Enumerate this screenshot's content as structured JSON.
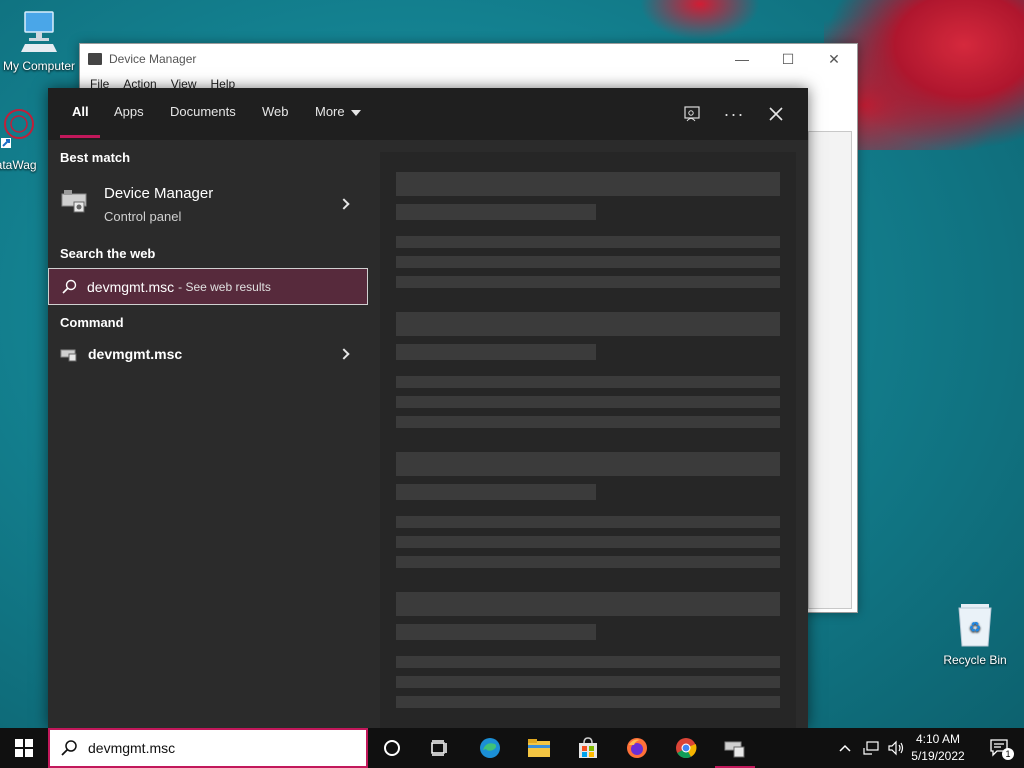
{
  "desktop": {
    "icons": [
      {
        "label": "My Computer"
      },
      {
        "label": "DataWag"
      },
      {
        "label": "Recycle Bin"
      }
    ]
  },
  "background_window": {
    "title": "Device Manager",
    "menu": [
      "File",
      "Action",
      "View",
      "Help"
    ]
  },
  "search": {
    "tabs": [
      {
        "label": "All",
        "active": true
      },
      {
        "label": "Apps"
      },
      {
        "label": "Documents"
      },
      {
        "label": "Web"
      },
      {
        "label": "More"
      }
    ],
    "sections": {
      "best_match": "Best match",
      "search_web": "Search the web",
      "command": "Command"
    },
    "best_match_item": {
      "title": "Device Manager",
      "subtitle": "Control panel"
    },
    "web_item": {
      "query": "devmgmt.msc",
      "suffix": "- See web results"
    },
    "command_item": {
      "title": "devmgmt.msc"
    },
    "query": "devmgmt.msc"
  },
  "taskbar": {
    "clock_time": "4:10 AM",
    "clock_date": "5/19/2022",
    "notification_count": "1"
  },
  "colors": {
    "accent": "#c2185b",
    "selected_row": "#572a3c"
  }
}
